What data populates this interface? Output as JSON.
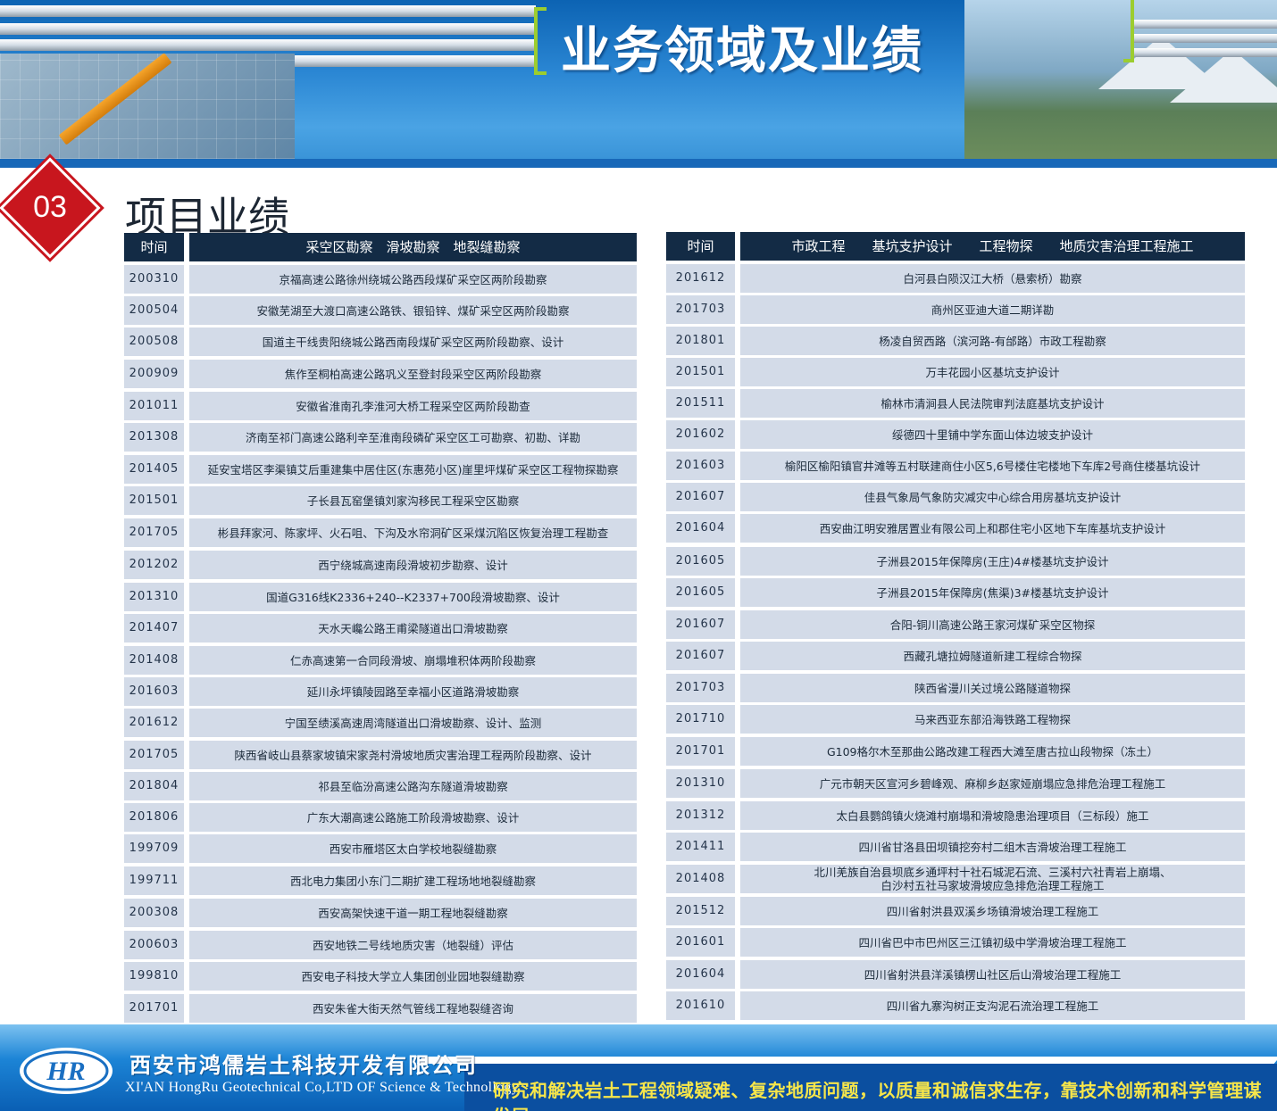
{
  "banner": {
    "title": "业务领域及业绩"
  },
  "section": {
    "number": "03",
    "title": "项目业绩"
  },
  "left_table": {
    "headers": [
      "时间",
      "采空区勘察　滑坡勘察　地裂缝勘察"
    ],
    "rows": [
      {
        "time": "200310",
        "desc": "京福高速公路徐州绕城公路西段煤矿采空区两阶段勘察"
      },
      {
        "time": "200504",
        "desc": "安徽芜湖至大渡口高速公路铁、银铅锌、煤矿采空区两阶段勘察"
      },
      {
        "time": "200508",
        "desc": "国道主干线贵阳绕城公路西南段煤矿采空区两阶段勘察、设计"
      },
      {
        "time": "200909",
        "desc": "焦作至桐柏高速公路巩义至登封段采空区两阶段勘察"
      },
      {
        "time": "201011",
        "desc": "安徽省淮南孔李淮河大桥工程采空区两阶段勘查"
      },
      {
        "time": "201308",
        "desc": "济南至祁门高速公路利辛至淮南段磷矿采空区工可勘察、初勘、详勘"
      },
      {
        "time": "201405",
        "desc": "延安宝塔区李渠镇艾后重建集中居住区(东惠苑小区)崖里坪煤矿采空区工程物探勘察"
      },
      {
        "time": "201501",
        "desc": "子长县瓦窑堡镇刘家沟移民工程采空区勘察"
      },
      {
        "time": "201705",
        "desc": "彬县拜家河、陈家坪、火石咀、下沟及水帘洞矿区采煤沉陷区恢复治理工程勘查"
      },
      {
        "time": "201202",
        "desc": "西宁绕城高速南段滑坡初步勘察、设计"
      },
      {
        "time": "201310",
        "desc": "国道G316线K2336+240--K2337+700段滑坡勘察、设计"
      },
      {
        "time": "201407",
        "desc": "天水天巉公路王甫梁隧道出口滑坡勘察"
      },
      {
        "time": "201408",
        "desc": "仁赤高速第一合同段滑坡、崩塌堆积体两阶段勘察"
      },
      {
        "time": "201603",
        "desc": "延川永坪镇陵园路至幸福小区道路滑坡勘察"
      },
      {
        "time": "201612",
        "desc": "宁国至绩溪高速周湾隧道出口滑坡勘察、设计、监测"
      },
      {
        "time": "201705",
        "desc": "陕西省岐山县蔡家坡镇宋家尧村滑坡地质灾害治理工程两阶段勘察、设计"
      },
      {
        "time": "201804",
        "desc": "祁县至临汾高速公路沟东隧道滑坡勘察"
      },
      {
        "time": "201806",
        "desc": "广东大潮高速公路施工阶段滑坡勘察、设计"
      },
      {
        "time": "199709",
        "desc": "西安市雁塔区太白学校地裂缝勘察"
      },
      {
        "time": "199711",
        "desc": "西北电力集团小东门二期扩建工程场地地裂缝勘察"
      },
      {
        "time": "200308",
        "desc": "西安高架快速干道一期工程地裂缝勘察"
      },
      {
        "time": "200603",
        "desc": "西安地铁二号线地质灾害（地裂缝）评估"
      },
      {
        "time": "199810",
        "desc": "西安电子科技大学立人集团创业园地裂缝勘察"
      },
      {
        "time": "201701",
        "desc": "西安朱雀大街天然气管线工程地裂缝咨询"
      }
    ]
  },
  "right_table": {
    "headers": [
      "时间",
      "市政工程　　基坑支护设计　　工程物探　　地质灾害治理工程施工"
    ],
    "rows": [
      {
        "time": "201612",
        "desc": "白河县白陨汉江大桥（悬索桥）勘察"
      },
      {
        "time": "201703",
        "desc": "商州区亚迪大道二期详勘"
      },
      {
        "time": "201801",
        "desc": "杨凌自贸西路（滨河路-有邰路）市政工程勘察"
      },
      {
        "time": "201501",
        "desc": "万丰花园小区基坑支护设计"
      },
      {
        "time": "201511",
        "desc": "榆林市清涧县人民法院审判法庭基坑支护设计"
      },
      {
        "time": "201602",
        "desc": "绥德四十里铺中学东面山体边坡支护设计"
      },
      {
        "time": "201603",
        "desc": "榆阳区榆阳镇官井滩等五村联建商住小区5,6号楼住宅楼地下车库2号商住楼基坑设计"
      },
      {
        "time": "201607",
        "desc": "佳县气象局气象防灾减灾中心综合用房基坑支护设计"
      },
      {
        "time": "201604",
        "desc": "西安曲江明安雅居置业有限公司上和郡住宅小区地下车库基坑支护设计"
      },
      {
        "time": "201605",
        "desc": "子洲县2015年保障房(王庄)4#楼基坑支护设计"
      },
      {
        "time": "201605",
        "desc": "子洲县2015年保障房(焦渠)3#楼基坑支护设计"
      },
      {
        "time": "201607",
        "desc": "合阳-铜川高速公路王家河煤矿采空区物探"
      },
      {
        "time": "201607",
        "desc": "西藏孔塘拉姆隧道新建工程综合物探"
      },
      {
        "time": "201703",
        "desc": "陕西省漫川关过境公路隧道物探"
      },
      {
        "time": "201710",
        "desc": "马来西亚东部沿海铁路工程物探"
      },
      {
        "time": "201701",
        "desc": "G109格尔木至那曲公路改建工程西大滩至唐古拉山段物探（冻土）"
      },
      {
        "time": "201310",
        "desc": "广元市朝天区宣河乡碧峰观、麻柳乡赵家娅崩塌应急排危治理工程施工"
      },
      {
        "time": "201312",
        "desc": "太白县鹦鸽镇火烧滩村崩塌和滑坡隐患治理项目（三标段）施工"
      },
      {
        "time": "201411",
        "desc": "四川省甘洛县田坝镇挖夯村二组木吉滑坡治理工程施工"
      },
      {
        "time": "201408",
        "desc": "北川羌族自治县坝底乡通坪村十社石城泥石流、三溪村六社青岩上崩塌、\n白沙村五社马家坡滑坡应急排危治理工程施工"
      },
      {
        "time": "201512",
        "desc": "四川省射洪县双溪乡场镇滑坡治理工程施工"
      },
      {
        "time": "201601",
        "desc": "四川省巴中市巴州区三江镇初级中学滑坡治理工程施工"
      },
      {
        "time": "201604",
        "desc": "四川省射洪县洋溪镇楞山社区后山滑坡治理工程施工"
      },
      {
        "time": "201610",
        "desc": "四川省九寨沟树正支沟泥石流治理工程施工"
      }
    ]
  },
  "footer": {
    "company_cn": "西安市鸿儒岩土科技开发有限公司",
    "company_en": "XI'AN HongRu Geotechnical Co,LTD OF Science & Technollogy",
    "slogan": "研究和解决岩土工程领域疑难、复杂地质问题，以质量和诚信求生存，靠技术创新和科学管理谋发展",
    "logo_text": "HR"
  }
}
